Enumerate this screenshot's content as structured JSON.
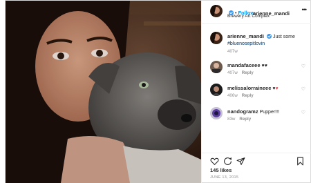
{
  "post": {
    "author": "arienne_mandi",
    "follow_label": "Follow",
    "separator": "•",
    "location": "Brewery Art Complex",
    "caption_prefix": "Just some",
    "caption_hashtag": "#bluenosepitlovin",
    "caption_age": "407w",
    "likes": "145 likes",
    "date": "JUNE 13, 2015"
  },
  "comments": [
    {
      "user": "mandafaceee",
      "text": "♥♥",
      "age": "407w",
      "reply": "Reply"
    },
    {
      "user": "melissalorraineee",
      "text": "♥",
      "text2": "♥",
      "age": "406w",
      "reply": "Reply"
    },
    {
      "user": "nandogramz",
      "text": "Pupper!!!",
      "age": "83w",
      "reply": "Reply"
    }
  ],
  "colors": {
    "link_blue": "#0095f6",
    "hashtag": "#00376b",
    "heart_red": "#ed4956",
    "muted": "#8e8e8e"
  },
  "icons": [
    "more-icon",
    "verified-badge-icon",
    "heart-icon",
    "comment-icon",
    "share-icon",
    "bookmark-icon"
  ]
}
